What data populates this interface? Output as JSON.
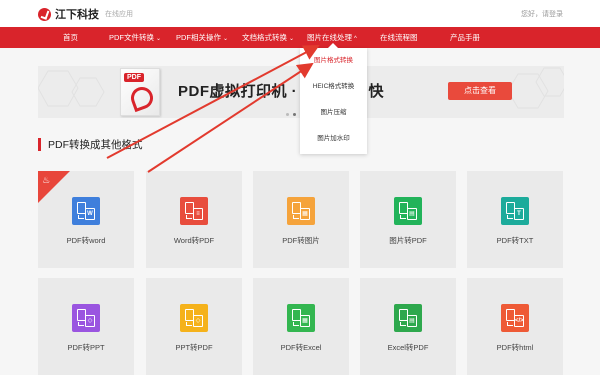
{
  "header": {
    "logo_text": "江下科技",
    "logo_sub": "在线应用",
    "login_text": "您好，请登录"
  },
  "nav": {
    "items": [
      {
        "label": "首页",
        "caret": ""
      },
      {
        "label": "PDF文件转换",
        "caret": "⌄"
      },
      {
        "label": "PDF相关操作",
        "caret": "⌄"
      },
      {
        "label": "文档格式转换",
        "caret": "⌄"
      },
      {
        "label": "图片在线处理",
        "caret": "^"
      },
      {
        "label": "在线流程图",
        "caret": ""
      },
      {
        "label": "产品手册",
        "caret": ""
      }
    ]
  },
  "dropdown": {
    "items": [
      "图片格式转换",
      "HEIC格式转换",
      "图片压缩",
      "图片加水印"
    ]
  },
  "banner": {
    "pdf_tag": "PDF",
    "title": "PDF虚拟打印机 · 支          件打印快",
    "button": "点击查看"
  },
  "section": {
    "title": "PDF转换成其他格式"
  },
  "cards": [
    {
      "label": "PDF转word",
      "color": "#3f7fdc",
      "glyph": "W",
      "hot": true
    },
    {
      "label": "Word转PDF",
      "color": "#e84d3d",
      "glyph": "≡",
      "hot": false
    },
    {
      "label": "PDF转图片",
      "color": "#f5a33b",
      "glyph": "▦",
      "hot": false
    },
    {
      "label": "图片转PDF",
      "color": "#22b35a",
      "glyph": "▤",
      "hot": false
    },
    {
      "label": "PDF转TXT",
      "color": "#1cab9b",
      "glyph": "T",
      "hot": false
    },
    {
      "label": "PDF转PPT",
      "color": "#9a55e0",
      "glyph": "◇",
      "hot": false
    },
    {
      "label": "PPT转PDF",
      "color": "#f5b21b",
      "glyph": "◇",
      "hot": false
    },
    {
      "label": "PDF转Excel",
      "color": "#33b650",
      "glyph": "▦",
      "hot": false
    },
    {
      "label": "Excel转PDF",
      "color": "#2ea84d",
      "glyph": "▤",
      "hot": false
    },
    {
      "label": "PDF转html",
      "color": "#ee5a36",
      "glyph": "</>",
      "hot": false
    }
  ],
  "colors": {
    "brand": "#d9242b",
    "arrow": "#e23a2e"
  }
}
